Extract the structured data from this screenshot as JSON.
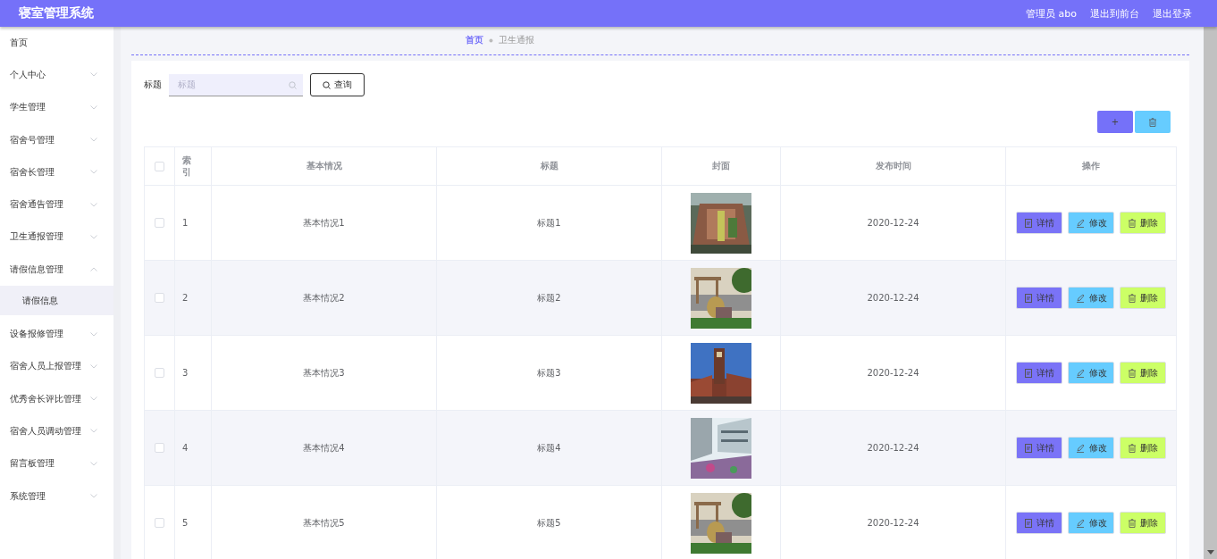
{
  "header": {
    "title": "寝室管理系统",
    "user": "管理员 abo",
    "links": [
      "退出到前台",
      "退出登录"
    ]
  },
  "sidebar": {
    "items": [
      {
        "label": "首页",
        "kind": "link"
      },
      {
        "label": "个人中心",
        "kind": "group",
        "expanded": false
      },
      {
        "label": "学生管理",
        "kind": "group",
        "expanded": false
      },
      {
        "label": "宿舍号管理",
        "kind": "group",
        "expanded": false
      },
      {
        "label": "宿舍长管理",
        "kind": "group",
        "expanded": false
      },
      {
        "label": "宿舍通告管理",
        "kind": "group",
        "expanded": false
      },
      {
        "label": "卫生通报管理",
        "kind": "group",
        "expanded": false
      },
      {
        "label": "请假信息管理",
        "kind": "group",
        "expanded": true,
        "children": [
          {
            "label": "请假信息",
            "selected": true
          }
        ]
      },
      {
        "label": "设备报修管理",
        "kind": "group",
        "expanded": false
      },
      {
        "label": "宿舍人员上报管理",
        "kind": "group",
        "expanded": false
      },
      {
        "label": "优秀舍长评比管理",
        "kind": "group",
        "expanded": false
      },
      {
        "label": "宿舍人员调动管理",
        "kind": "group",
        "expanded": false
      },
      {
        "label": "留言板管理",
        "kind": "group",
        "expanded": false
      },
      {
        "label": "系统管理",
        "kind": "group",
        "expanded": false
      }
    ]
  },
  "breadcrumb": [
    {
      "label": "首页",
      "kind": "link"
    },
    {
      "label": "卫生通报",
      "kind": "current"
    }
  ],
  "search": {
    "label": "标题",
    "placeholder": "标题",
    "button": "查询"
  },
  "toolbar": {
    "add": "+"
  },
  "table": {
    "header_checkbox": {
      "checked": false
    },
    "columns": [
      "索引",
      "基本情况",
      "标题",
      "封面",
      "发布时间",
      "操作"
    ],
    "rows": [
      {
        "checked": false,
        "index": "1",
        "basic": "基本情况1",
        "title": "标题1",
        "date": "2020-12-24",
        "actions": [
          "详情",
          "修改",
          "删除"
        ]
      },
      {
        "checked": false,
        "index": "2",
        "basic": "基本情况2",
        "title": "标题2",
        "date": "2020-12-24",
        "actions": [
          "详情",
          "修改",
          "删除"
        ]
      },
      {
        "checked": false,
        "index": "3",
        "basic": "基本情况3",
        "title": "标题3",
        "date": "2020-12-24",
        "actions": [
          "详情",
          "修改",
          "删除"
        ]
      },
      {
        "checked": false,
        "index": "4",
        "basic": "基本情况4",
        "title": "标题4",
        "date": "2020-12-24",
        "actions": [
          "详情",
          "修改",
          "删除"
        ]
      },
      {
        "checked": false,
        "index": "5",
        "basic": "基本情况5",
        "title": "标题5",
        "date": "2020-12-24",
        "actions": [
          "详情",
          "修改",
          "删除"
        ]
      }
    ]
  }
}
